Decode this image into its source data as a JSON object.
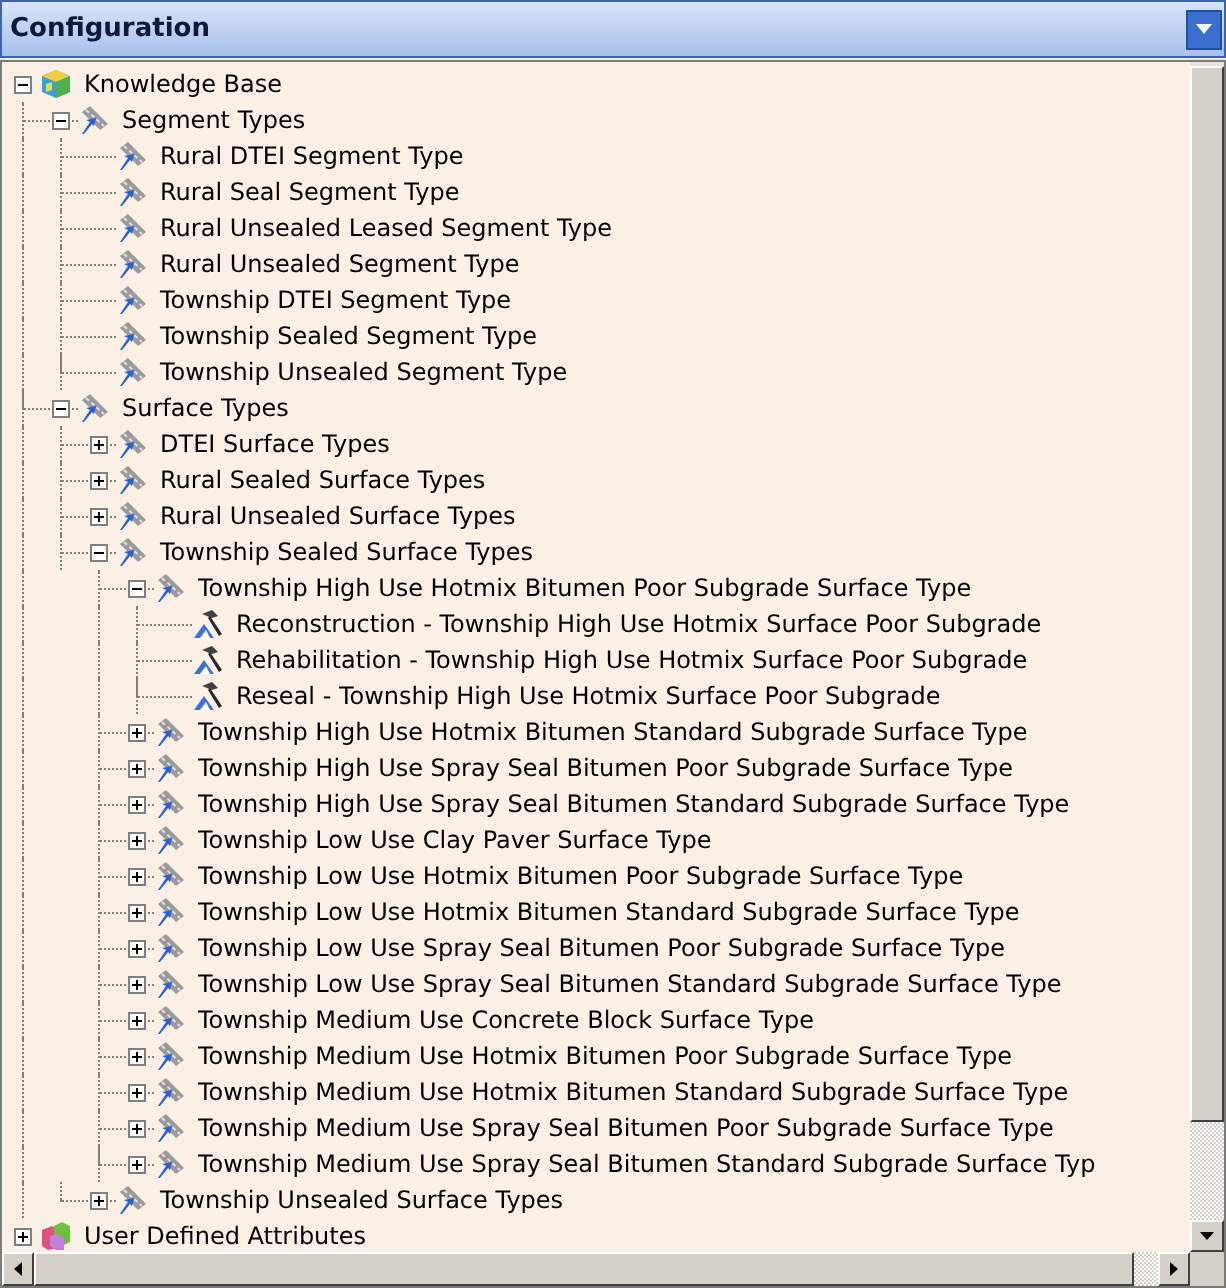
{
  "panel": {
    "title": "Configuration"
  },
  "tree": [
    {
      "label": "Knowledge Base",
      "kind": "database",
      "expanded": true,
      "children": [
        {
          "label": "Segment Types",
          "kind": "road",
          "expanded": true,
          "children": [
            {
              "label": "Rural DTEI Segment Type",
              "kind": "road"
            },
            {
              "label": "Rural Seal Segment Type",
              "kind": "road"
            },
            {
              "label": "Rural Unsealed Leased Segment Type",
              "kind": "road"
            },
            {
              "label": "Rural Unsealed Segment Type",
              "kind": "road"
            },
            {
              "label": "Township DTEI Segment Type",
              "kind": "road"
            },
            {
              "label": "Township Sealed Segment Type",
              "kind": "road"
            },
            {
              "label": "Township Unsealed Segment Type",
              "kind": "road"
            }
          ]
        },
        {
          "label": "Surface Types",
          "kind": "road",
          "expanded": true,
          "children": [
            {
              "label": "DTEI Surface Types",
              "kind": "road",
              "expanded": false
            },
            {
              "label": "Rural Sealed Surface Types",
              "kind": "road",
              "expanded": false
            },
            {
              "label": "Rural Unsealed Surface Types",
              "kind": "road",
              "expanded": false
            },
            {
              "label": "Township Sealed Surface Types",
              "kind": "road",
              "expanded": true,
              "children": [
                {
                  "label": "Township High Use Hotmix Bitumen Poor Subgrade Surface Type",
                  "kind": "road",
                  "expanded": true,
                  "children": [
                    {
                      "label": "Reconstruction - Township High Use Hotmix Surface Poor Subgrade",
                      "kind": "hammer"
                    },
                    {
                      "label": "Rehabilitation - Township High Use Hotmix Surface Poor Subgrade",
                      "kind": "hammer"
                    },
                    {
                      "label": "Reseal - Township High Use Hotmix Surface Poor Subgrade",
                      "kind": "hammer"
                    }
                  ]
                },
                {
                  "label": "Township High Use Hotmix Bitumen Standard Subgrade Surface Type",
                  "kind": "road",
                  "expanded": false
                },
                {
                  "label": "Township High Use Spray Seal Bitumen Poor Subgrade Surface Type",
                  "kind": "road",
                  "expanded": false
                },
                {
                  "label": "Township High Use Spray Seal Bitumen Standard Subgrade Surface Type",
                  "kind": "road",
                  "expanded": false
                },
                {
                  "label": "Township Low Use Clay Paver Surface Type",
                  "kind": "road",
                  "expanded": false
                },
                {
                  "label": "Township Low Use Hotmix Bitumen Poor Subgrade Surface Type",
                  "kind": "road",
                  "expanded": false
                },
                {
                  "label": "Township Low Use Hotmix Bitumen Standard Subgrade Surface Type",
                  "kind": "road",
                  "expanded": false
                },
                {
                  "label": "Township Low Use Spray Seal Bitumen Poor Subgrade Surface Type",
                  "kind": "road",
                  "expanded": false
                },
                {
                  "label": "Township Low Use Spray Seal Bitumen Standard Subgrade Surface Type",
                  "kind": "road",
                  "expanded": false
                },
                {
                  "label": "Township Medium Use Concrete Block Surface Type",
                  "kind": "road",
                  "expanded": false
                },
                {
                  "label": "Township Medium Use Hotmix Bitumen Poor Subgrade Surface Type",
                  "kind": "road",
                  "expanded": false
                },
                {
                  "label": "Township Medium Use Hotmix Bitumen Standard Subgrade Surface Type",
                  "kind": "road",
                  "expanded": false
                },
                {
                  "label": "Township Medium Use Spray Seal Bitumen Poor Subgrade Surface Type",
                  "kind": "road",
                  "expanded": false
                },
                {
                  "label": "Township Medium Use Spray Seal Bitumen Standard Subgrade Surface Typ",
                  "kind": "road",
                  "expanded": false
                }
              ]
            },
            {
              "label": "Township Unsealed Surface Types",
              "kind": "road",
              "expanded": false
            }
          ]
        }
      ]
    },
    {
      "label": "User Defined Attributes",
      "kind": "attributes",
      "expanded": false
    }
  ]
}
